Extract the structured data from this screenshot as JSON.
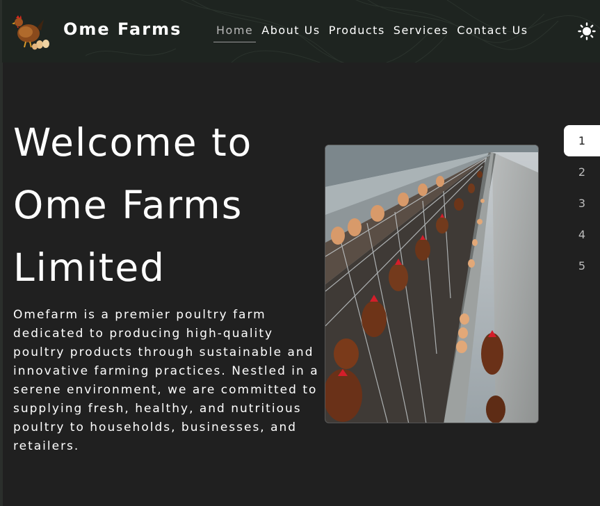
{
  "header": {
    "brand": "Ome Farms",
    "logo_icon": "hen-with-eggs-icon",
    "theme_icon": "sun-icon",
    "nav": [
      {
        "label": "Home",
        "active": true
      },
      {
        "label": "About Us",
        "active": false
      },
      {
        "label": "Products",
        "active": false
      },
      {
        "label": "Services",
        "active": false
      },
      {
        "label": "Contact Us",
        "active": false
      }
    ]
  },
  "hero": {
    "title": "Welcome to Ome Farms Limited",
    "description": "Omefarm is a premier poultry farm dedicated to producing high-quality poultry products through sustainable and innovative farming practices. Nestled in a serene environment, we are committed to supplying fresh, healthy, and nutritious poultry to households, businesses, and retailers.",
    "image": "poultry-cage-hens-eggs-photo"
  },
  "pager": {
    "pages": [
      "1",
      "2",
      "3",
      "4",
      "5"
    ],
    "active": "1"
  },
  "colors": {
    "background": "#202020",
    "header": "#1e2420",
    "text": "#ffffff"
  }
}
